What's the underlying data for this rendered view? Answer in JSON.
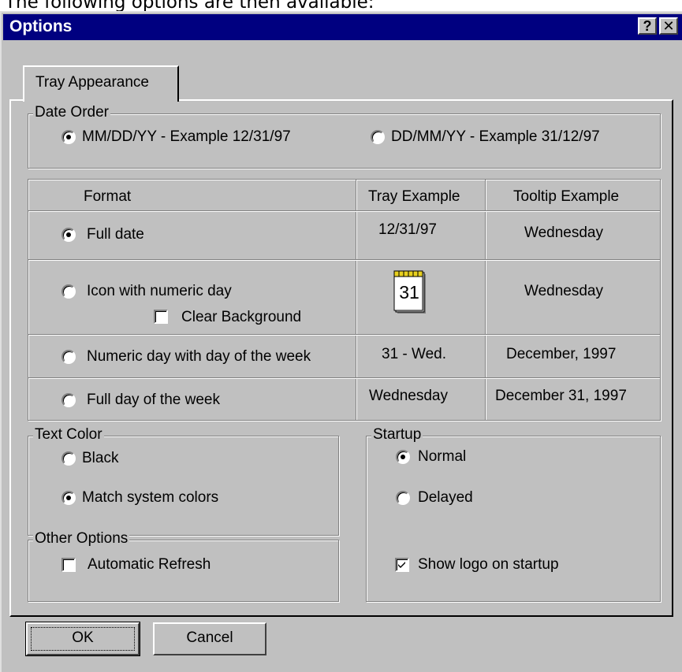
{
  "context_text": "The following options are then available:",
  "window": {
    "title": "Options",
    "help_button": "?",
    "close_button": "✕"
  },
  "tab": {
    "label": "Tray Appearance"
  },
  "date_order": {
    "legend": "Date Order",
    "options": [
      {
        "label": "MM/DD/YY - Example 12/31/97",
        "selected": true
      },
      {
        "label": "DD/MM/YY - Example 31/12/97",
        "selected": false
      }
    ]
  },
  "format_table": {
    "headers": [
      "Format",
      "Tray Example",
      "Tooltip Example"
    ],
    "rows": [
      {
        "format": "Full date",
        "tray": "12/31/97",
        "tooltip": "Wednesday",
        "selected": true
      },
      {
        "format": "Icon with numeric day",
        "tray": "31",
        "tooltip": "Wednesday",
        "selected": false,
        "suboption": "Clear Background",
        "suboption_checked": false
      },
      {
        "format": "Numeric day with day of the week",
        "tray": "31 - Wed.",
        "tooltip": "December, 1997",
        "selected": false
      },
      {
        "format": "Full day of the week",
        "tray": "Wednesday",
        "tooltip": "December 31, 1997",
        "selected": false
      }
    ]
  },
  "text_color": {
    "legend": "Text Color",
    "options": [
      {
        "label": "Black",
        "selected": false
      },
      {
        "label": "Match system colors",
        "selected": true
      }
    ]
  },
  "other_options": {
    "legend": "Other Options",
    "auto_refresh_label": "Automatic Refresh",
    "auto_refresh_checked": false
  },
  "startup": {
    "legend": "Startup",
    "options": [
      {
        "label": "Normal",
        "selected": true
      },
      {
        "label": "Delayed",
        "selected": false
      }
    ],
    "show_logo_label": "Show logo on startup",
    "show_logo_checked": true
  },
  "buttons": {
    "ok": "OK",
    "cancel": "Cancel"
  },
  "colors": {
    "titlebar": "#000080",
    "face": "#c0c0c0",
    "shadow": "#808080"
  }
}
